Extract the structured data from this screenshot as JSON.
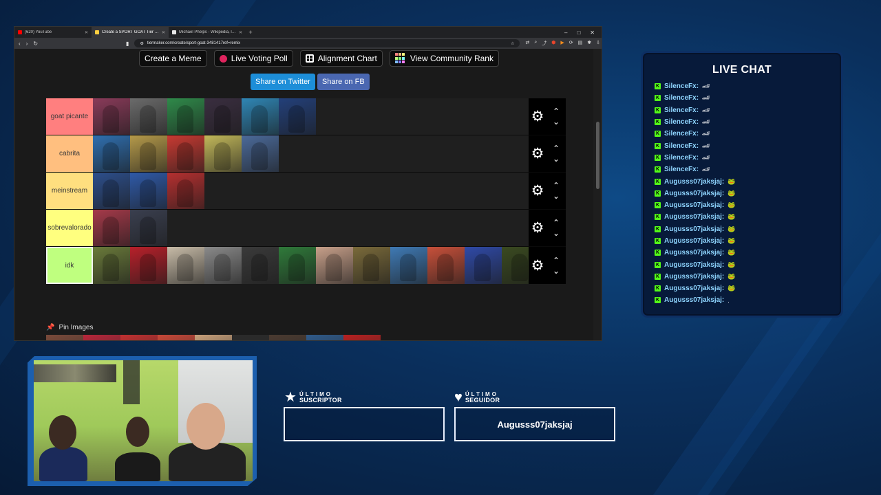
{
  "browser": {
    "tabs": [
      {
        "title": "(620) YouTube",
        "color": "#ff0000",
        "active": false
      },
      {
        "title": "Create a SPORT GOAT Tier List",
        "color": "#ffcf40",
        "active": true
      },
      {
        "title": "Michael Phelps - Wikipedia, la encicl…",
        "color": "#e6e6e6",
        "active": false
      }
    ],
    "url": "tiermaker.com/create/sport-goat-3481417ref=remix"
  },
  "page": {
    "buttons": {
      "meme": "Create a Meme",
      "poll": "Live Voting Poll",
      "alignment": "Alignment Chart",
      "community": "View Community Rank",
      "twitter": "Share on Twitter",
      "fb": "Share on FB"
    },
    "colors": {
      "twitter": "#1d8ed8",
      "fb": "#4a67b1"
    },
    "tiers": [
      {
        "label": "goat picante",
        "color": "#ff7f7f",
        "items": [
          "#8a3b5a",
          "#6b6b6b",
          "#2f8a4a",
          "#3a2e40",
          "#2f86b5",
          "#23407a"
        ]
      },
      {
        "label": "cabrita",
        "color": "#ffbf7f",
        "items": [
          "#2f6fb0",
          "#b59a4a",
          "#c83a32",
          "#c2b85a",
          "#4b6a9a"
        ]
      },
      {
        "label": "meinstream",
        "color": "#ffdf7f",
        "items": [
          "#2d4f8c",
          "#2f5aa8",
          "#b53030"
        ]
      },
      {
        "label": "sobrevalorado",
        "color": "#ffff7f",
        "items": [
          "#a63a4a",
          "#3a3f4f"
        ]
      },
      {
        "label": "idk",
        "color": "#bfff7f",
        "items": [
          "#6a7a3a",
          "#b8202a",
          "#c8bca8",
          "#8a8a8a",
          "#3a3a3a",
          "#2f7a3a",
          "#c8a08a",
          "#7a6a3a",
          "#3f7ab5",
          "#c8503a",
          "#2f4aa8",
          "#3a4a20"
        ]
      }
    ],
    "pin_label": "Pin Images",
    "pinned": [
      "#7a4a3a",
      "#b8263a",
      "#c23030",
      "#c84838",
      "#c8a07a",
      "#2a2a2a",
      "#4a3a30",
      "#2f5a8a",
      "#b82020"
    ]
  },
  "chat": {
    "title": "LIVE CHAT",
    "messages": [
      {
        "user": "SilenceFx:",
        "text": "🏎"
      },
      {
        "user": "SilenceFx:",
        "text": "🏎"
      },
      {
        "user": "SilenceFx:",
        "text": "🏎"
      },
      {
        "user": "SilenceFx:",
        "text": "🏎"
      },
      {
        "user": "SilenceFx:",
        "text": "🏎"
      },
      {
        "user": "SilenceFx:",
        "text": "🏎"
      },
      {
        "user": "SilenceFx:",
        "text": "🏎"
      },
      {
        "user": "SilenceFx:",
        "text": "🏎"
      },
      {
        "user": "Augusss07jaksjaj:",
        "text": "🐸"
      },
      {
        "user": "Augusss07jaksjaj:",
        "text": "🐸"
      },
      {
        "user": "Augusss07jaksjaj:",
        "text": "🐸"
      },
      {
        "user": "Augusss07jaksjaj:",
        "text": "🐸"
      },
      {
        "user": "Augusss07jaksjaj:",
        "text": "🐸"
      },
      {
        "user": "Augusss07jaksjaj:",
        "text": "🐸"
      },
      {
        "user": "Augusss07jaksjaj:",
        "text": "🐸"
      },
      {
        "user": "Augusss07jaksjaj:",
        "text": "🐸"
      },
      {
        "user": "Augusss07jaksjaj:",
        "text": "🐸"
      },
      {
        "user": "Augusss07jaksjaj:",
        "text": "🐸"
      },
      {
        "user": "Augusss07jaksjaj:",
        "text": "."
      }
    ]
  },
  "overlay": {
    "sub_small": "ÚLTIMO",
    "sub_big": "SUSCRIPTOR",
    "sub_name": "",
    "fol_small": "ÚLTIMO",
    "fol_big": "SEGUIDOR",
    "fol_name": "Augusss07jaksjaj"
  }
}
